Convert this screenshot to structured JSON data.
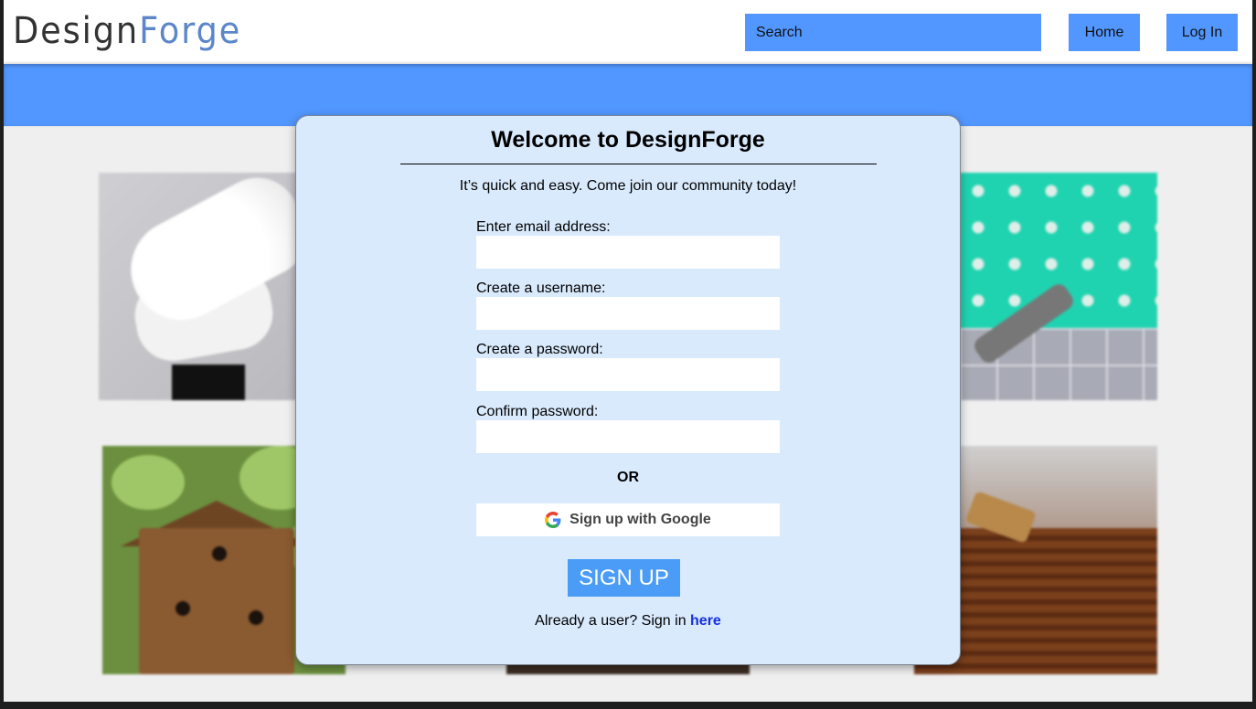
{
  "header": {
    "logo_part1": "Design",
    "logo_part2": "Forge",
    "search_placeholder": "Search",
    "home_label": "Home",
    "login_label": "Log In"
  },
  "signup_modal": {
    "title": "Welcome to DesignForge",
    "subtitle": "It’s quick and easy. Come join our community today!",
    "fields": [
      {
        "label": "Enter email address:",
        "value": ""
      },
      {
        "label": "Create a username:",
        "value": ""
      },
      {
        "label": "Create a password:",
        "value": ""
      },
      {
        "label": "Confirm password:",
        "value": ""
      }
    ],
    "or_label": "OR",
    "google_label": "Sign up with Google",
    "signup_label": "SIGN UP",
    "already_text": "Already a user? Sign in ",
    "signin_link": "here"
  },
  "colors": {
    "accent_blue": "#5297ff",
    "modal_bg": "#d9eafd",
    "signup_button": "#4a9cf6",
    "link": "#1530e0"
  },
  "icons": [
    "google-g-icon"
  ]
}
